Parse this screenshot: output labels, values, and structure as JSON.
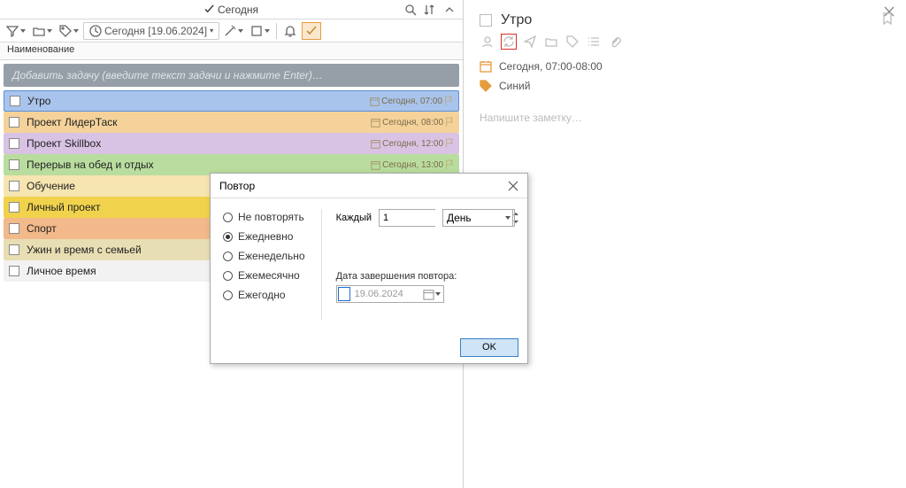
{
  "header": {
    "title": "Сегодня"
  },
  "toolbar": {
    "date_label": "Сегодня [19.06.2024]"
  },
  "column_header": "Наименование",
  "add_placeholder": "Добавить задачу (введите текст задачи и нажмите Enter)…",
  "tasks": [
    {
      "name": "Утро",
      "date": "Сегодня, 07:00"
    },
    {
      "name": "Проект ЛидерТаск",
      "date": "Сегодня, 08:00"
    },
    {
      "name": "Проект Skillbox",
      "date": "Сегодня, 12:00"
    },
    {
      "name": "Перерыв на обед и отдых",
      "date": "Сегодня, 13:00"
    },
    {
      "name": "Обучение",
      "date": ""
    },
    {
      "name": "Личный проект",
      "date": ""
    },
    {
      "name": "Спорт",
      "date": ""
    },
    {
      "name": "Ужин и время с семьей",
      "date": ""
    },
    {
      "name": "Личное время",
      "date": ""
    }
  ],
  "detail": {
    "title": "Утро",
    "date_line": "Сегодня, 07:00-08:00",
    "color_line": "Синий",
    "note_placeholder": "Напишите заметку…"
  },
  "dialog": {
    "title": "Повтор",
    "opts": [
      "Не повторять",
      "Ежедневно",
      "Еженедельно",
      "Ежемесячно",
      "Ежегодно"
    ],
    "every_label": "Каждый",
    "every_value": "1",
    "unit": "День",
    "end_label": "Дата завершения повтора:",
    "end_date": "19.06.2024",
    "ok": "OK"
  }
}
